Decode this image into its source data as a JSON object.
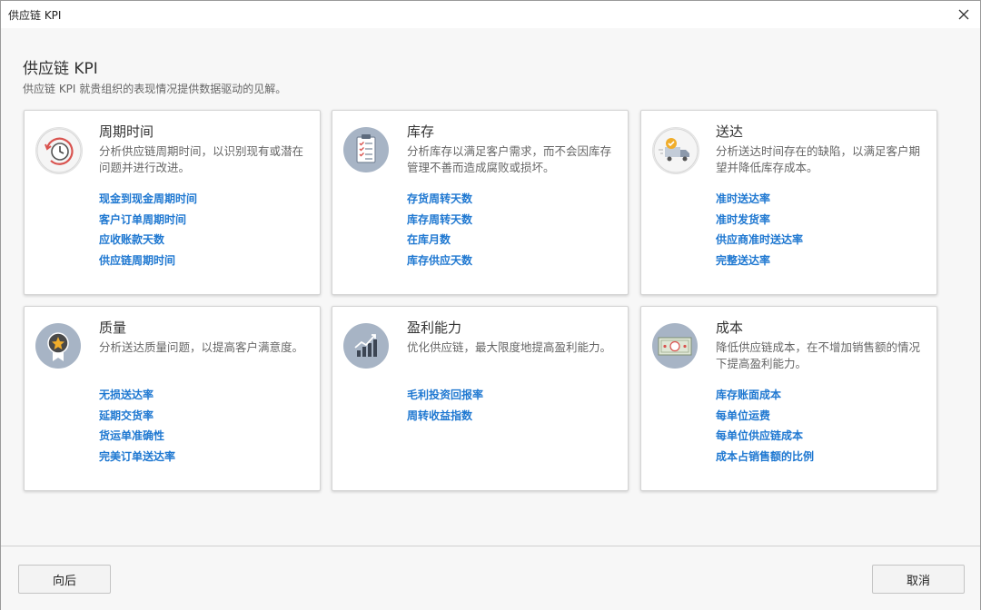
{
  "window": {
    "title": "供应链 KPI"
  },
  "header": {
    "title": "供应链 KPI",
    "subtitle": "供应链 KPI 就贵组织的表现情况提供数据驱动的见解。"
  },
  "cards": [
    {
      "title": "周期时间",
      "description": "分析供应链周期时间，以识别现有或潜在问题并进行改进。",
      "icon": "clock-cycle-icon",
      "links": [
        "现金到现金周期时间",
        "客户订单周期时间",
        "应收账款天数",
        "供应链周期时间"
      ]
    },
    {
      "title": "库存",
      "description": "分析库存以满足客户需求，而不会因库存管理不善而造成腐败或损坏。",
      "icon": "clipboard-checklist-icon",
      "links": [
        "存货周转天数",
        "库存周转天数",
        "在库月数",
        "库存供应天数"
      ]
    },
    {
      "title": "送达",
      "description": "分析送达时间存在的缺陷，以满足客户期望并降低库存成本。",
      "icon": "delivery-truck-icon",
      "links": [
        "准时送达率",
        "准时发货率",
        "供应商准时送达率",
        "完整送达率"
      ]
    },
    {
      "title": "质量",
      "description": "分析送达质量问题，以提高客户满意度。",
      "icon": "award-badge-icon",
      "links": [
        "无损送达率",
        "延期交货率",
        "货运单准确性",
        "完美订单送达率"
      ]
    },
    {
      "title": "盈利能力",
      "description": "优化供应链，最大限度地提高盈利能力。",
      "icon": "rising-bar-chart-icon",
      "links": [
        "毛利投资回报率",
        "周转收益指数"
      ]
    },
    {
      "title": "成本",
      "description": "降低供应链成本，在不增加销售额的情况下提高盈利能力。",
      "icon": "money-bill-icon",
      "links": [
        "库存账面成本",
        "每单位运费",
        "每单位供应链成本",
        "成本占销售额的比例"
      ]
    }
  ],
  "footer": {
    "back_label": "向后",
    "cancel_label": "取消"
  },
  "colors": {
    "link": "#1f78d1",
    "icon_bg": "#a7b4c5",
    "accent_red": "#d9534f",
    "accent_orange": "#f0ad2b"
  }
}
